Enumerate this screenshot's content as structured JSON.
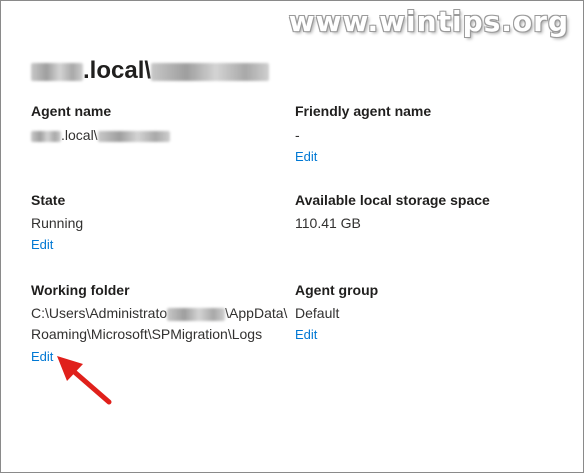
{
  "watermark": "www.wintips.org",
  "agent_title": {
    "domain_suffix": ".local\\"
  },
  "fields": {
    "agent_name": {
      "label": "Agent name",
      "domain_suffix": ".local\\"
    },
    "friendly_agent_name": {
      "label": "Friendly agent name",
      "value": "-",
      "edit": "Edit"
    },
    "state": {
      "label": "State",
      "value": "Running",
      "edit": "Edit"
    },
    "available_storage": {
      "label": "Available local storage space",
      "value": "110.41 GB"
    },
    "working_folder": {
      "label": "Working folder",
      "line1_prefix": "C:\\Users\\Administrato",
      "line1_suffix": "\\AppData\\",
      "line2": "Roaming\\Microsoft\\SPMigration\\Logs",
      "edit": "Edit"
    },
    "agent_group": {
      "label": "Agent group",
      "value": "Default",
      "edit": "Edit"
    }
  },
  "colors": {
    "link": "#0078d4",
    "annotation_arrow": "#e0201b",
    "text": "#323130",
    "heading": "#201f1e"
  },
  "icons": {
    "annotation": "red-arrow-icon"
  }
}
